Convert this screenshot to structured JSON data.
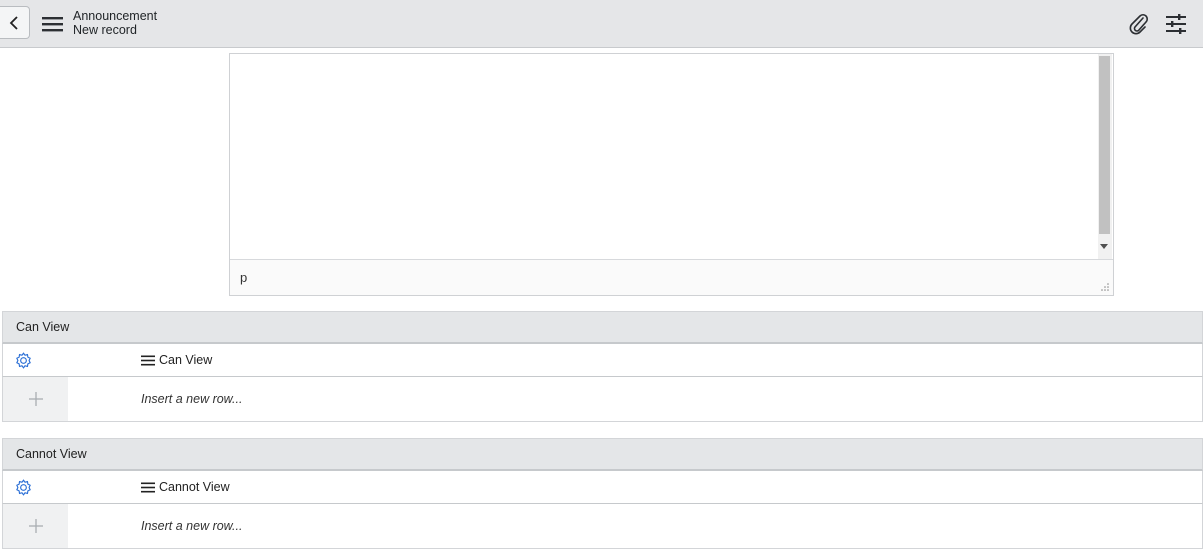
{
  "header": {
    "title": "Announcement",
    "subtitle": "New record",
    "icons": {
      "back": "chevron-left-icon",
      "menu": "hamburger-menu-icon",
      "attach": "paperclip-icon",
      "settings": "sliders-icon"
    }
  },
  "editor": {
    "element_path": "p"
  },
  "related_lists": [
    {
      "title": "Can View",
      "column_label": "Can View",
      "insert_row_text": "Insert a new row..."
    },
    {
      "title": "Cannot View",
      "column_label": "Cannot View",
      "insert_row_text": "Insert a new row..."
    }
  ],
  "colors": {
    "header_bg": "#e5e6e8",
    "section_head_bg": "#e4e6e8",
    "gear_accent": "#2b6fd6"
  }
}
